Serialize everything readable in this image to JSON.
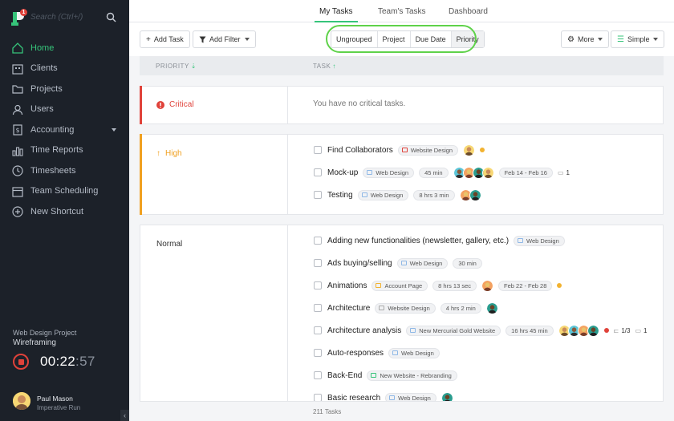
{
  "sidebar": {
    "search_placeholder": "Search (Ctrl+/)",
    "logo_badge": "1",
    "items": [
      {
        "label": "Home",
        "icon": "home-icon",
        "active": true
      },
      {
        "label": "Clients",
        "icon": "clients-icon"
      },
      {
        "label": "Projects",
        "icon": "folder-icon"
      },
      {
        "label": "Users",
        "icon": "user-icon"
      },
      {
        "label": "Accounting",
        "icon": "invoice-icon",
        "has_caret": true
      },
      {
        "label": "Time Reports",
        "icon": "bar-chart-icon"
      },
      {
        "label": "Timesheets",
        "icon": "clock-icon"
      },
      {
        "label": "Team Scheduling",
        "icon": "calendar-icon"
      },
      {
        "label": "New Shortcut",
        "icon": "plus-circle-icon"
      }
    ],
    "timer": {
      "project": "Web Design Project",
      "task": "Wireframing",
      "time_main": "00:22",
      "time_sec": ":57"
    },
    "user": {
      "name": "Paul Mason",
      "org": "Imperative Run"
    },
    "collapse_glyph": "‹"
  },
  "tabs": [
    {
      "label": "My Tasks",
      "active": true
    },
    {
      "label": "Team's Tasks"
    },
    {
      "label": "Dashboard"
    }
  ],
  "toolbar": {
    "add_task": "Add Task",
    "add_filter": "Add Filter",
    "group_options": [
      "Ungrouped",
      "Project",
      "Due Date",
      "Priority"
    ],
    "more": "More",
    "simple": "Simple"
  },
  "columns": {
    "priority": "PRIORITY",
    "task": "TASK"
  },
  "groups": {
    "critical": {
      "label": "Critical",
      "empty": "You have no critical tasks.",
      "color": "#e0423a"
    },
    "high": {
      "label": "High",
      "color": "#f0a020",
      "tasks": [
        {
          "name": "Find Collaborators",
          "project": "Website Design",
          "project_color": "#e0423a",
          "avatars": 1,
          "dot": "#f2b230"
        },
        {
          "name": "Mock-up",
          "project": "Web Design",
          "project_color": "#8fb8e6",
          "time": "45 min",
          "avatars": 4,
          "dates": "Feb 14 - Feb 16",
          "comments": "1"
        },
        {
          "name": "Testing",
          "project": "Web Design",
          "project_color": "#8fb8e6",
          "time": "8 hrs 3 min",
          "avatars": 2
        }
      ]
    },
    "normal": {
      "label": "Normal",
      "tasks": [
        {
          "name": "Adding new functionalities (newsletter, gallery, etc.)",
          "project": "Web Design",
          "project_color": "#8fb8e6"
        },
        {
          "name": "Ads buying/selling",
          "project": "Web Design",
          "project_color": "#8fb8e6",
          "time": "30 min"
        },
        {
          "name": "Animations",
          "project": "Account Page",
          "project_color": "#f2b230",
          "time": "8 hrs 13 sec",
          "avatars": 1,
          "dates": "Feb 22 - Feb 28",
          "dot": "#f2b230"
        },
        {
          "name": "Architecture",
          "project": "Website Design",
          "project_color": "#aaaaaa",
          "time": "4 hrs 2 min",
          "avatars": 1
        },
        {
          "name": "Architecture analysis",
          "project": "New Mercurial Gold Website",
          "project_color": "#8fb8e6",
          "time": "16 hrs 45 min",
          "avatars": 4,
          "dot": "#e0423a",
          "subtasks": "1/3",
          "comments": "1"
        },
        {
          "name": "Auto-responses",
          "project": "Web Design",
          "project_color": "#8fb8e6"
        },
        {
          "name": "Back-End",
          "project": "New Website - Rebranding",
          "project_color": "#36c47a"
        },
        {
          "name": "Basic research",
          "project": "Web Design",
          "project_color": "#8fb8e6",
          "avatars": 1
        }
      ]
    }
  },
  "footer": {
    "count": "211 Tasks"
  }
}
